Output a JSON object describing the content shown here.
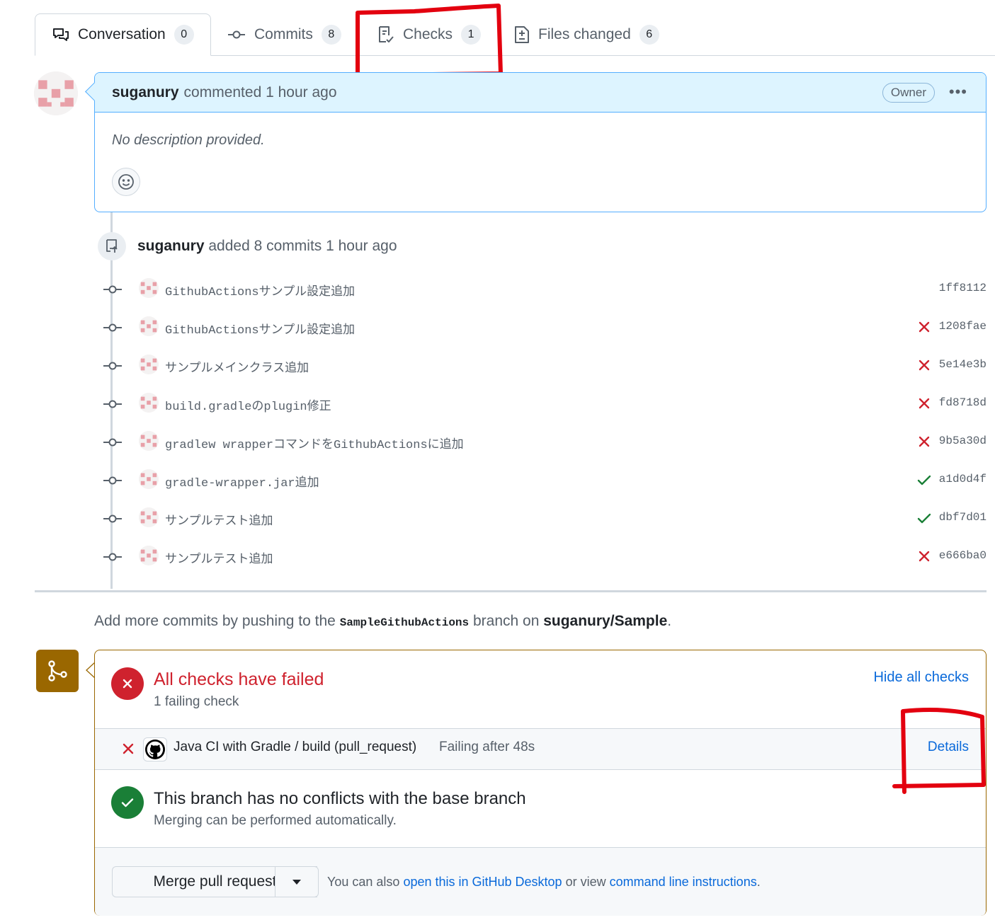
{
  "tabs": [
    {
      "label": "Conversation",
      "count": "0"
    },
    {
      "label": "Commits",
      "count": "8"
    },
    {
      "label": "Checks",
      "count": "1"
    },
    {
      "label": "Files changed",
      "count": "6"
    }
  ],
  "comment": {
    "author": "suganury",
    "action": "commented 1 hour ago",
    "badge": "Owner",
    "menu_icon": "kebab-horizontal-icon",
    "body": "No description provided.",
    "reaction_icon": "smiley-icon"
  },
  "commits_event": {
    "author": "suganury",
    "action": "added 8 commits 1 hour ago",
    "icon": "repo-push-icon"
  },
  "commits": [
    {
      "message": "GithubActionsサンプル設定追加",
      "sha": "1ff8112",
      "status": "none"
    },
    {
      "message": "GithubActionsサンプル設定追加",
      "sha": "1208fae",
      "status": "failure"
    },
    {
      "message": "サンプルメインクラス追加",
      "sha": "5e14e3b",
      "status": "failure"
    },
    {
      "message": "build.gradleのplugin修正",
      "sha": "fd8718d",
      "status": "failure"
    },
    {
      "message": "gradlew wrapperコマンドをGithubActionsに追加",
      "sha": "9b5a30d",
      "status": "failure"
    },
    {
      "message": "gradle-wrapper.jar追加",
      "sha": "a1d0d4f",
      "status": "success"
    },
    {
      "message": "サンプルテスト追加",
      "sha": "dbf7d01",
      "status": "success"
    },
    {
      "message": "サンプルテスト追加",
      "sha": "e666ba0",
      "status": "failure"
    }
  ],
  "push_hint": {
    "prefix": "Add more commits by pushing to the",
    "branch": "SampleGithubActions",
    "middle": "branch on",
    "repo": "suganury/Sample",
    "suffix": "."
  },
  "checks": {
    "title": "All checks have failed",
    "subtitle": "1 failing check",
    "toggle": "Hide all checks",
    "item": {
      "name": "Java CI with Gradle / build (pull_request)",
      "status_text": "Failing after 48s",
      "details": "Details",
      "app_icon": "github-mark-icon"
    }
  },
  "conflicts": {
    "title": "This branch has no conflicts with the base branch",
    "subtitle": "Merging can be performed automatically."
  },
  "merge": {
    "button": "Merge pull request",
    "hint_prefix": "You can also",
    "desktop_link": "open this in GitHub Desktop",
    "hint_middle": "or view",
    "cli_link": "command line instructions",
    "hint_suffix": "."
  },
  "colors": {
    "danger": "#cf222e",
    "success": "#1a7f37",
    "link": "#0969da",
    "merge_badge": "#9a6700",
    "annotation": "#e3000f"
  }
}
